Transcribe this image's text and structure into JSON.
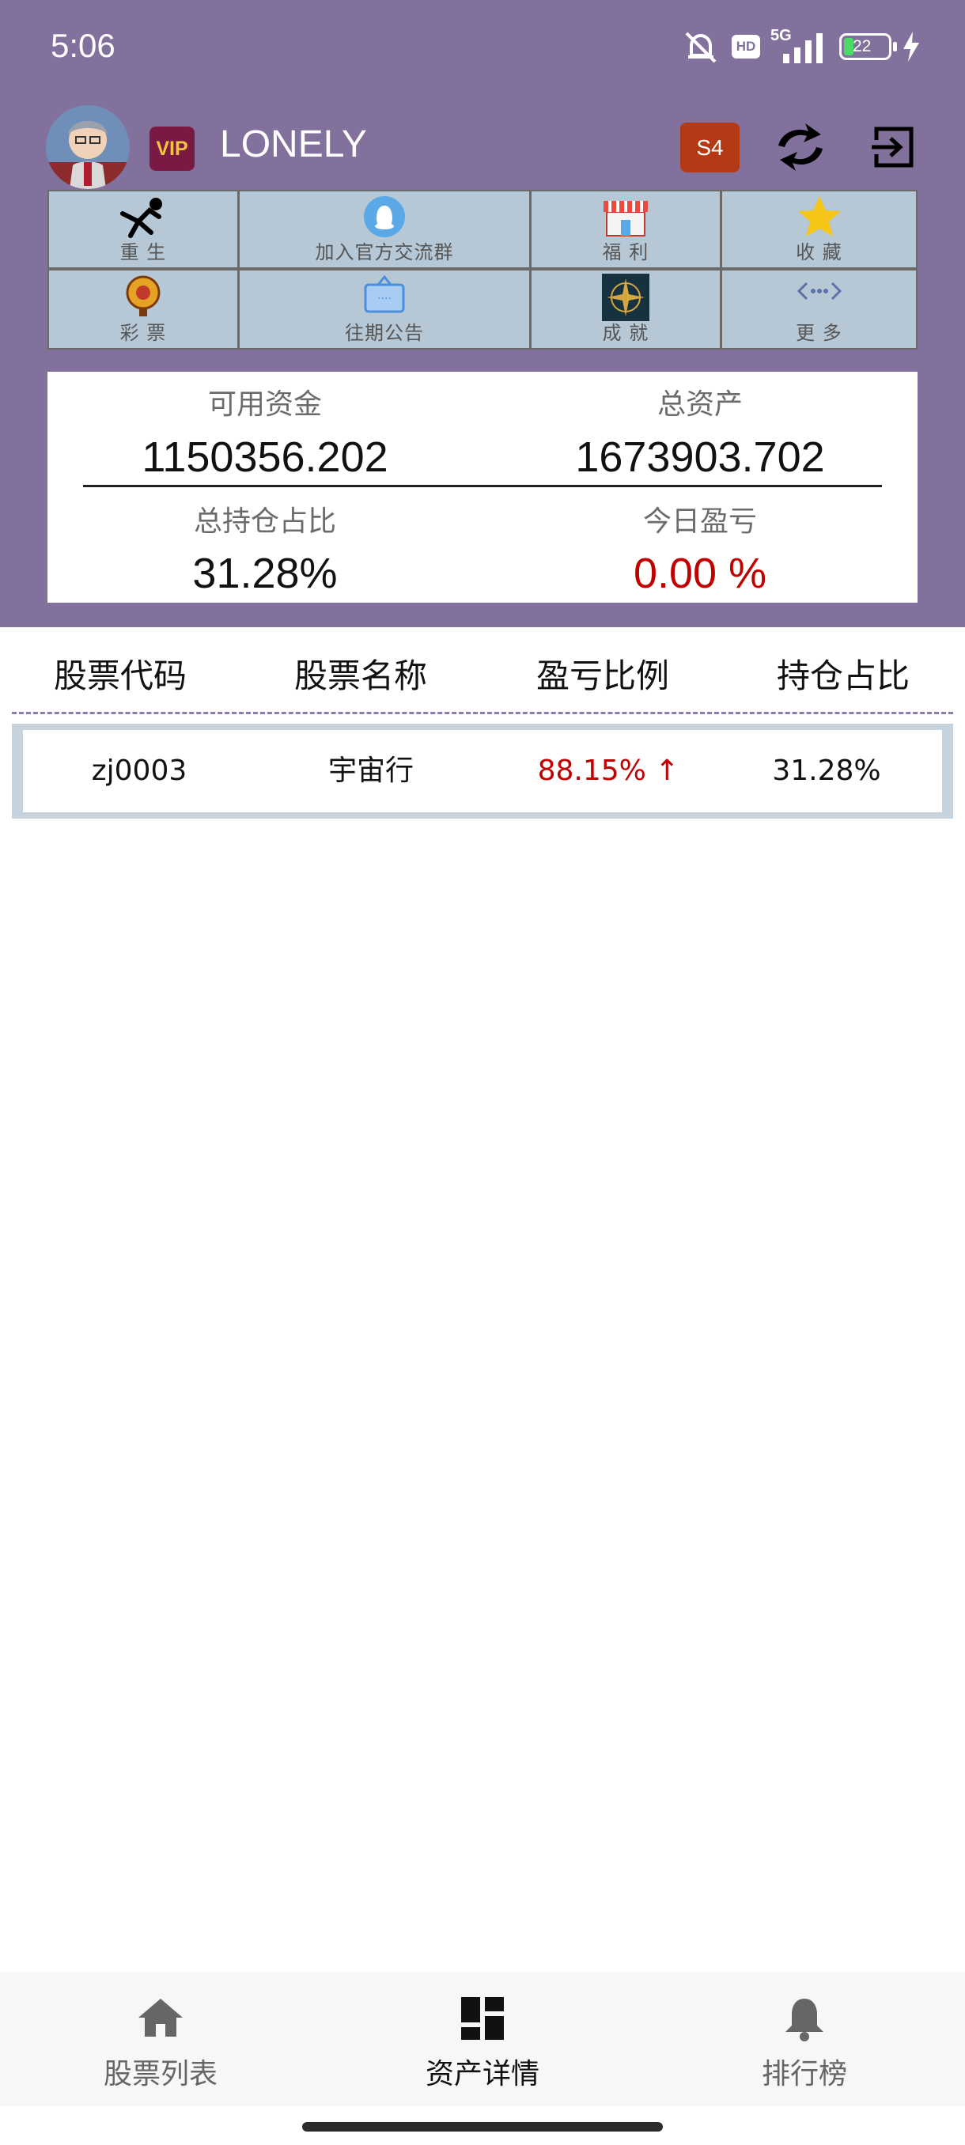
{
  "status_bar": {
    "time": "5:06",
    "network": "5G",
    "hd": "HD",
    "battery": "22"
  },
  "user": {
    "vip_label": "VIP",
    "name": "LONELY",
    "season_badge": "S4"
  },
  "menu": {
    "items": [
      {
        "label": "重 生",
        "icon": "falling-person-icon"
      },
      {
        "label": "加入官方交流群",
        "icon": "qq-penguin-icon"
      },
      {
        "label": "福 利",
        "icon": "shop-icon"
      },
      {
        "label": "收 藏",
        "icon": "star-icon"
      },
      {
        "label": "彩 票",
        "icon": "lottery-wheel-icon"
      },
      {
        "label": "往期公告",
        "icon": "notice-board-icon"
      },
      {
        "label": "成 就",
        "icon": "achievement-compass-icon"
      },
      {
        "label": "更 多",
        "icon": "more-dots-icon"
      }
    ]
  },
  "stats": {
    "available_funds_label": "可用资金",
    "available_funds_value": "1150356.202",
    "total_assets_label": "总资产",
    "total_assets_value": "1673903.702",
    "position_ratio_label": "总持仓占比",
    "position_ratio_value": "31.28%",
    "today_pnl_label": "今日盈亏",
    "today_pnl_value": "0.00 %"
  },
  "table": {
    "headers": [
      "股票代码",
      "股票名称",
      "盈亏比例",
      "持仓占比"
    ],
    "rows": [
      {
        "code": "zj0003",
        "name": "宇宙行",
        "pnl": "88.15% ↑",
        "position": "31.28%"
      }
    ]
  },
  "bottom_nav": {
    "items": [
      {
        "label": "股票列表",
        "icon": "home-icon",
        "active": false
      },
      {
        "label": "资产详情",
        "icon": "dashboard-icon",
        "active": true
      },
      {
        "label": "排行榜",
        "icon": "bell-icon",
        "active": false
      }
    ]
  },
  "colors": {
    "header_bg": "#83719d",
    "menu_cell_bg": "#b6c8d5",
    "gain_red": "#c00000",
    "vip_bg": "#7a1a44",
    "season_bg": "#b33a14"
  }
}
